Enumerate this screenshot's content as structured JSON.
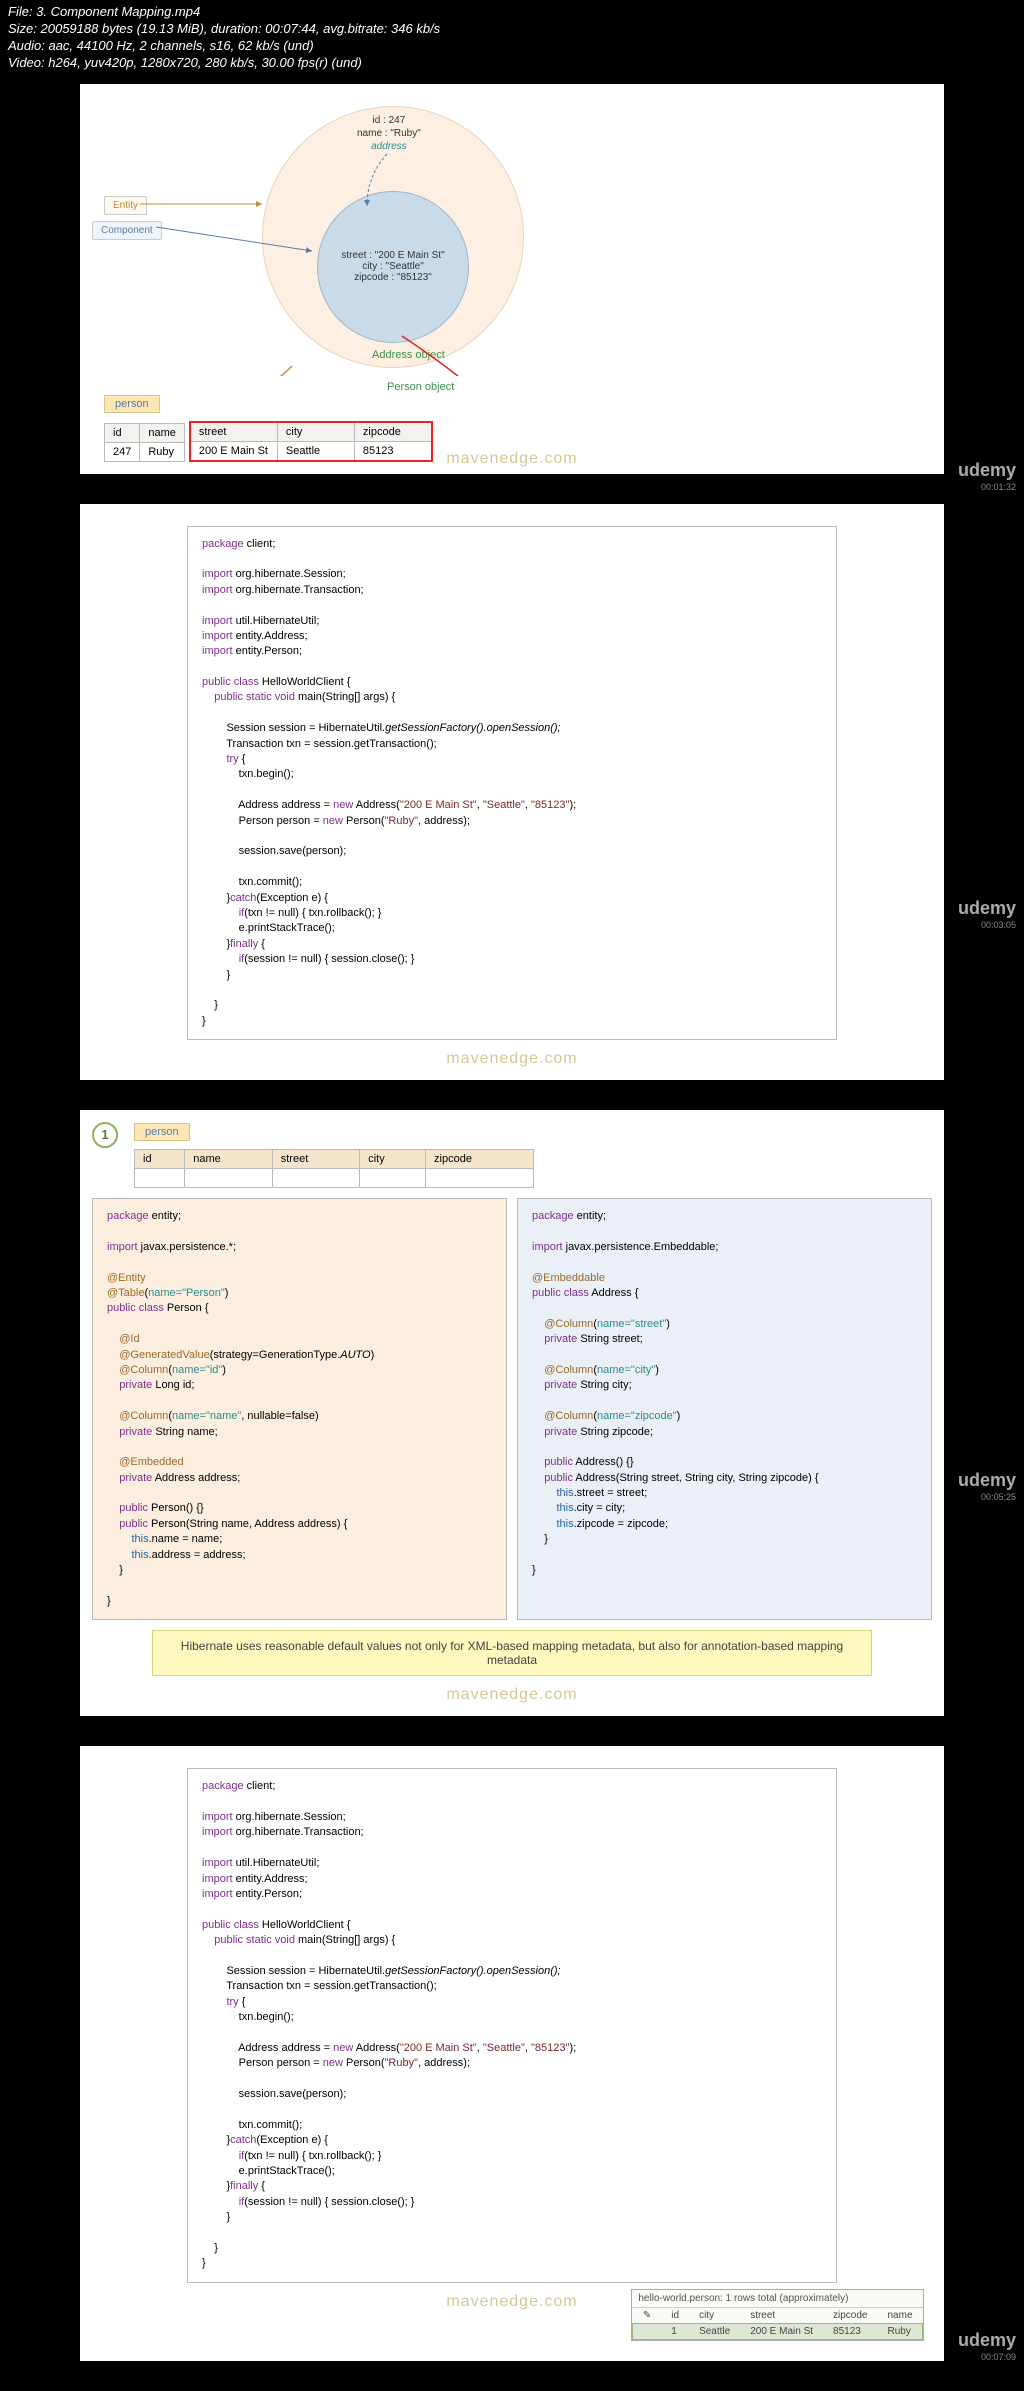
{
  "meta": {
    "file": "File: 3. Component Mapping.mp4",
    "size": "Size: 20059188 bytes (19.13 MiB), duration: 00:07:44, avg.bitrate: 346 kb/s",
    "audio": "Audio: aac, 44100 Hz, 2 channels, s16, 62 kb/s (und)",
    "video": "Video: h264, yuv420p, 1280x720, 280 kb/s, 30.00 fps(r) (und)"
  },
  "brand": {
    "mavenedge": "mavenedge.com",
    "udemy": "udemy"
  },
  "timestamps": [
    "00:01:32",
    "00:03:05",
    "00:05:25",
    "00:07:09"
  ],
  "slide1": {
    "person_obj": {
      "l1": "id : 247",
      "l2": "name : \"Ruby\"",
      "addr_ref": "address"
    },
    "address_obj": {
      "l1": "street : \"200 E Main St\"",
      "l2": "city : \"Seattle\"",
      "l3": "zipcode : \"85123\""
    },
    "legend": {
      "entity": "Entity",
      "component": "Component"
    },
    "labels": {
      "address": "Address object",
      "person": "Person object"
    },
    "caption": "person",
    "table": {
      "headers": [
        "id",
        "name",
        "street",
        "city",
        "zipcode"
      ],
      "row": [
        "247",
        "Ruby",
        "200 E Main St",
        "Seattle",
        "85123"
      ]
    }
  },
  "slide3": {
    "step": "1",
    "caption": "person",
    "headers": [
      "id",
      "name",
      "street",
      "city",
      "zipcode"
    ],
    "note": "Hibernate uses reasonable default values not only for XML-based mapping metadata, but also for annotation-based mapping metadata"
  },
  "slide4": {
    "result_head": "hello-world.person: 1 rows total (approximately)",
    "result_headers": [
      "id",
      "city",
      "street",
      "zipcode",
      "name"
    ],
    "result_row": [
      "1",
      "Seattle",
      "200 E Main St",
      "85123",
      "Ruby"
    ]
  }
}
